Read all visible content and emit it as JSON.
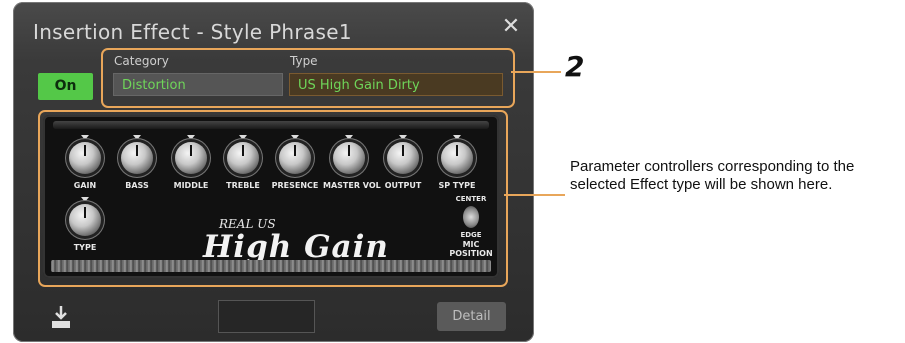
{
  "dialog": {
    "title": "Insertion Effect - Style Phrase1",
    "close_icon": "close-icon"
  },
  "toggle": {
    "label": "On",
    "state": "on"
  },
  "category": {
    "label": "Category",
    "value": "Distortion"
  },
  "type": {
    "label": "Type",
    "value": "US High Gain Dirty"
  },
  "amp": {
    "knobs": [
      "GAIN",
      "BASS",
      "MIDDLE",
      "TREBLE",
      "PRESENCE",
      "MASTER VOL",
      "OUTPUT",
      "SP TYPE"
    ],
    "type_knob": "TYPE",
    "brand_small": "REAL US",
    "brand_big": "High Gain",
    "mic": {
      "top": "CENTER",
      "bottom": "EDGE",
      "label": "MIC POSITION"
    }
  },
  "bottom": {
    "import_icon": "import-icon",
    "detail_label": "Detail"
  },
  "callouts": {
    "number": "2",
    "text": "Parameter controllers corresponding to the selected Effect type will be shown here."
  },
  "colors": {
    "accent": "#e8a65a",
    "on_green": "#54c848",
    "value_green": "#6fd65a"
  }
}
